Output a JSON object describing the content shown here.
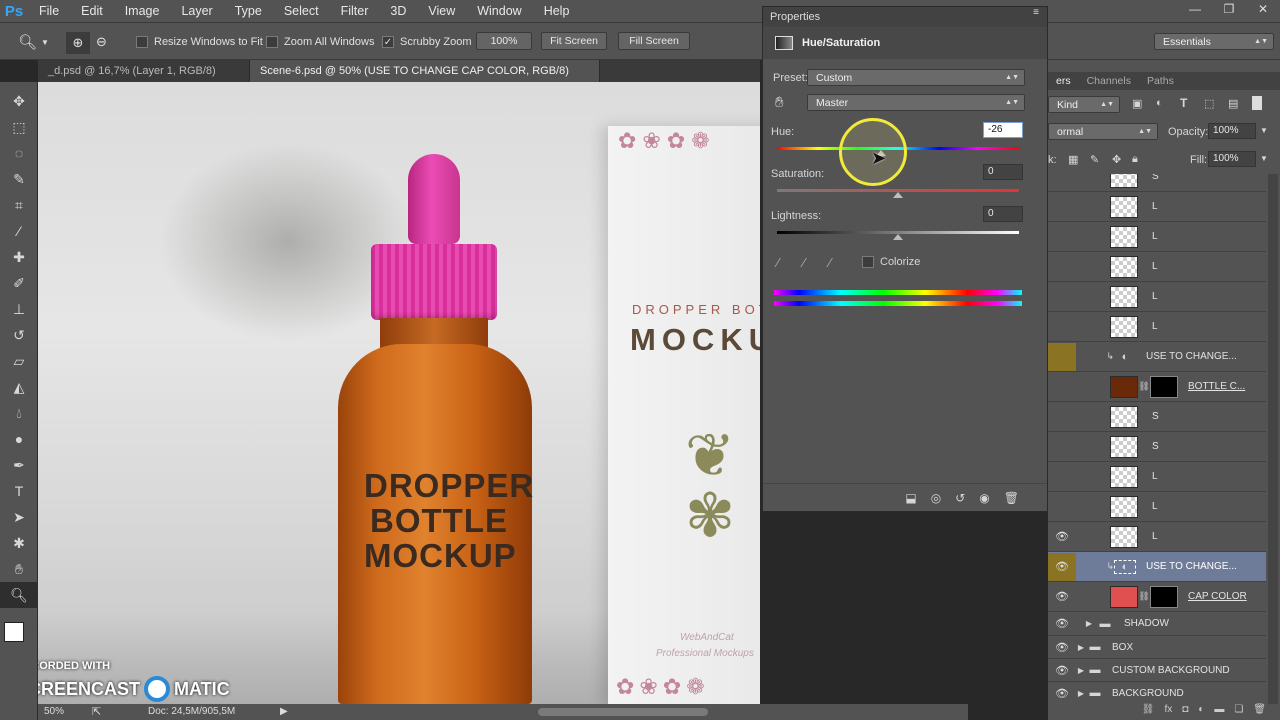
{
  "app": {
    "logo": "Ps"
  },
  "menu": [
    "File",
    "Edit",
    "Image",
    "Layer",
    "Type",
    "Select",
    "Filter",
    "3D",
    "View",
    "Window",
    "Help"
  ],
  "options": {
    "resize_windows": "Resize Windows to Fit",
    "zoom_all": "Zoom All Windows",
    "scrubby_zoom": "Scrubby Zoom",
    "zoom_value": "100%",
    "fit_screen": "Fit Screen",
    "fill_screen": "Fill Screen",
    "workspace": "Essentials"
  },
  "tabs": [
    {
      "label": "_d.psd @ 16,7% (Layer 1, RGB/8) *"
    },
    {
      "label": "Scene-6.psd @ 50% (USE TO CHANGE CAP COLOR, RGB/8) *"
    }
  ],
  "canvas": {
    "bottle_text": [
      "DROPPER",
      "BOTTLE",
      "MOCKUP"
    ],
    "box_title_1": "DROPPER BOTT",
    "box_title_2": "MOCKU",
    "box_brand_1": "WebAndCat",
    "box_brand_2": "Professional Mockups",
    "colors": {
      "cap": "#e23aa8",
      "bottle": "#c25a0f",
      "box_title": "#a55a4a"
    }
  },
  "status": {
    "zoom": "50%",
    "doc": "Doc: 24,5M/905,5M"
  },
  "watermark": {
    "line1": "RECORDED WITH",
    "brand1": "SCREENCAST",
    "brand2": "MATIC"
  },
  "properties": {
    "title": "Properties",
    "adjustment": "Hue/Saturation",
    "preset_label": "Preset:",
    "preset_value": "Custom",
    "channel_value": "Master",
    "hue_label": "Hue:",
    "hue_value": "-26",
    "saturation_label": "Saturation:",
    "saturation_value": "0",
    "lightness_label": "Lightness:",
    "lightness_value": "0",
    "colorize_label": "Colorize"
  },
  "layers_panel": {
    "tabs": [
      "ers",
      "Channels",
      "Paths"
    ],
    "kind": "Kind",
    "blend": "ormal",
    "opacity_label": "Opacity:",
    "opacity_value": "100%",
    "lock_label": "k:",
    "fill_label": "Fill:",
    "fill_value": "100%",
    "rows": [
      {
        "name": "S"
      },
      {
        "name": "L"
      },
      {
        "name": "L"
      },
      {
        "name": "L"
      },
      {
        "name": "L"
      },
      {
        "name": "L"
      },
      {
        "name": "USE TO CHANGE..."
      },
      {
        "name": "BOTTLE C..."
      },
      {
        "name": "S"
      },
      {
        "name": "S"
      },
      {
        "name": "L"
      },
      {
        "name": "L"
      },
      {
        "name": "L"
      },
      {
        "name": "USE TO CHANGE..."
      },
      {
        "name": "CAP COLOR"
      },
      {
        "name": "SHADOW"
      },
      {
        "name": "BOX"
      },
      {
        "name": "CUSTOM BACKGROUND"
      },
      {
        "name": "BACKGROUND"
      }
    ]
  }
}
